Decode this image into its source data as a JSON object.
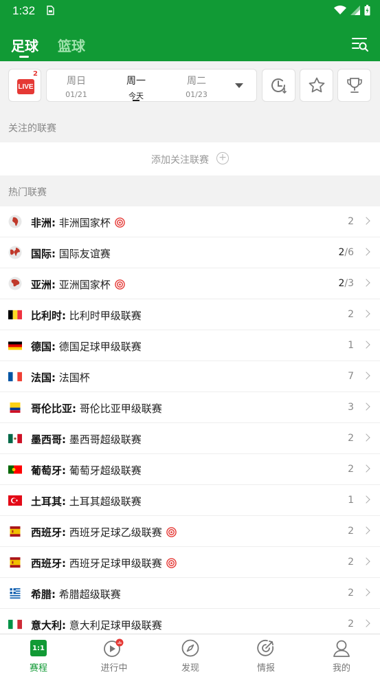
{
  "status": {
    "time": "1:32"
  },
  "header": {
    "tabs": [
      {
        "label": "足球",
        "active": true
      },
      {
        "label": "篮球",
        "active": false
      }
    ]
  },
  "datebar": {
    "live": {
      "label": "LIVE",
      "count": "2"
    },
    "dates": [
      {
        "day": "周日",
        "sub": "01/21",
        "active": false
      },
      {
        "day": "周一",
        "sub": "今天",
        "active": true
      },
      {
        "day": "周二",
        "sub": "01/23",
        "active": false
      }
    ]
  },
  "followed": {
    "title": "关注的联赛",
    "add_label": "添加关注联赛",
    "add_icon": "+"
  },
  "hot": {
    "title": "热门联赛",
    "leagues": [
      {
        "region": "非洲:",
        "league": "非洲国家杯",
        "live": "",
        "total": "2",
        "target": true,
        "flag": "globe-africa"
      },
      {
        "region": "国际:",
        "league": "国际友谊赛",
        "live": "2",
        "total": "/6",
        "target": false,
        "flag": "globe-intl"
      },
      {
        "region": "亚洲:",
        "league": "亚洲国家杯",
        "live": "2",
        "total": "/3",
        "target": true,
        "flag": "globe-asia"
      },
      {
        "region": "比利时:",
        "league": "比利时甲级联赛",
        "live": "",
        "total": "2",
        "target": false,
        "flag": "belgium"
      },
      {
        "region": "德国:",
        "league": "德国足球甲级联赛",
        "live": "",
        "total": "1",
        "target": false,
        "flag": "germany"
      },
      {
        "region": "法国:",
        "league": "法国杯",
        "live": "",
        "total": "7",
        "target": false,
        "flag": "france"
      },
      {
        "region": "哥伦比亚:",
        "league": "哥伦比亚甲级联赛",
        "live": "",
        "total": "3",
        "target": false,
        "flag": "colombia"
      },
      {
        "region": "墨西哥:",
        "league": "墨西哥超级联赛",
        "live": "",
        "total": "2",
        "target": false,
        "flag": "mexico"
      },
      {
        "region": "葡萄牙:",
        "league": "葡萄牙超级联赛",
        "live": "",
        "total": "2",
        "target": false,
        "flag": "portugal"
      },
      {
        "region": "土耳其:",
        "league": "土耳其超级联赛",
        "live": "",
        "total": "1",
        "target": false,
        "flag": "turkey"
      },
      {
        "region": "西班牙:",
        "league": "西班牙足球乙级联赛",
        "live": "",
        "total": "2",
        "target": true,
        "flag": "spain"
      },
      {
        "region": "西班牙:",
        "league": "西班牙足球甲级联赛",
        "live": "",
        "total": "2",
        "target": true,
        "flag": "spain"
      },
      {
        "region": "希腊:",
        "league": "希腊超级联赛",
        "live": "",
        "total": "2",
        "target": false,
        "flag": "greece"
      },
      {
        "region": "意大利:",
        "league": "意大利足球甲级联赛",
        "live": "",
        "total": "2",
        "target": false,
        "flag": "italy"
      }
    ]
  },
  "nav": {
    "items": [
      {
        "label": "赛程",
        "icon": "schedule-icon",
        "icon_text": "1:1",
        "active": true
      },
      {
        "label": "进行中",
        "icon": "play-icon",
        "active": false
      },
      {
        "label": "发现",
        "icon": "compass-icon",
        "active": false
      },
      {
        "label": "情报",
        "icon": "intel-icon",
        "active": false
      },
      {
        "label": "我的",
        "icon": "profile-icon",
        "active": false
      }
    ]
  },
  "colors": {
    "brand": "#119a35",
    "live": "#e53935"
  }
}
